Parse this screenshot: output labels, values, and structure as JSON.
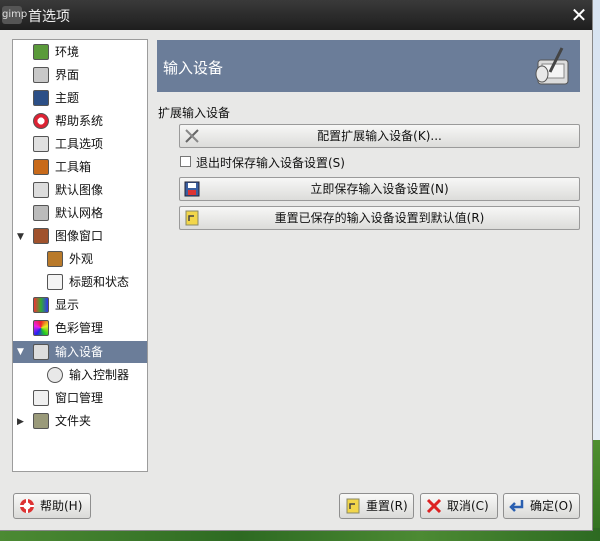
{
  "window": {
    "title": "首选项",
    "app_icon_text": "gimp"
  },
  "sidebar": {
    "items": [
      {
        "label": "环境",
        "icon": "environment-icon"
      },
      {
        "label": "界面",
        "icon": "interface-icon"
      },
      {
        "label": "主题",
        "icon": "theme-icon"
      },
      {
        "label": "帮助系统",
        "icon": "help-system-icon"
      },
      {
        "label": "工具选项",
        "icon": "tool-options-icon"
      },
      {
        "label": "工具箱",
        "icon": "toolbox-icon"
      },
      {
        "label": "默认图像",
        "icon": "default-image-icon"
      },
      {
        "label": "默认网格",
        "icon": "default-grid-icon"
      },
      {
        "label": "图像窗口",
        "icon": "image-window-icon"
      },
      {
        "label": "外观",
        "icon": "appearance-icon"
      },
      {
        "label": "标题和状态",
        "icon": "title-status-icon"
      },
      {
        "label": "显示",
        "icon": "display-icon"
      },
      {
        "label": "色彩管理",
        "icon": "color-management-icon"
      },
      {
        "label": "输入设备",
        "icon": "input-devices-icon"
      },
      {
        "label": "输入控制器",
        "icon": "input-controllers-icon"
      },
      {
        "label": "窗口管理",
        "icon": "window-management-icon"
      },
      {
        "label": "文件夹",
        "icon": "folders-icon"
      }
    ],
    "selected": "输入设备"
  },
  "main": {
    "header_title": "输入设备",
    "section_label": "扩展输入设备",
    "configure_button": "配置扩展输入设备(K)...",
    "save_on_exit_label": "退出时保存输入设备设置(S)",
    "save_on_exit_checked": false,
    "save_now_button": "立即保存输入设备设置(N)",
    "reset_button": "重置已保存的输入设备设置到默认值(R)"
  },
  "footer": {
    "help_button": "帮助(H)",
    "reset_button": "重置(R)",
    "cancel_button": "取消(C)",
    "ok_button": "确定(O)"
  },
  "colors": {
    "selection": "#6b7d99",
    "header_bg": "#6b7d99",
    "window_bg": "#e8e8e7",
    "titlebar_bg": "#1e1e1e"
  }
}
